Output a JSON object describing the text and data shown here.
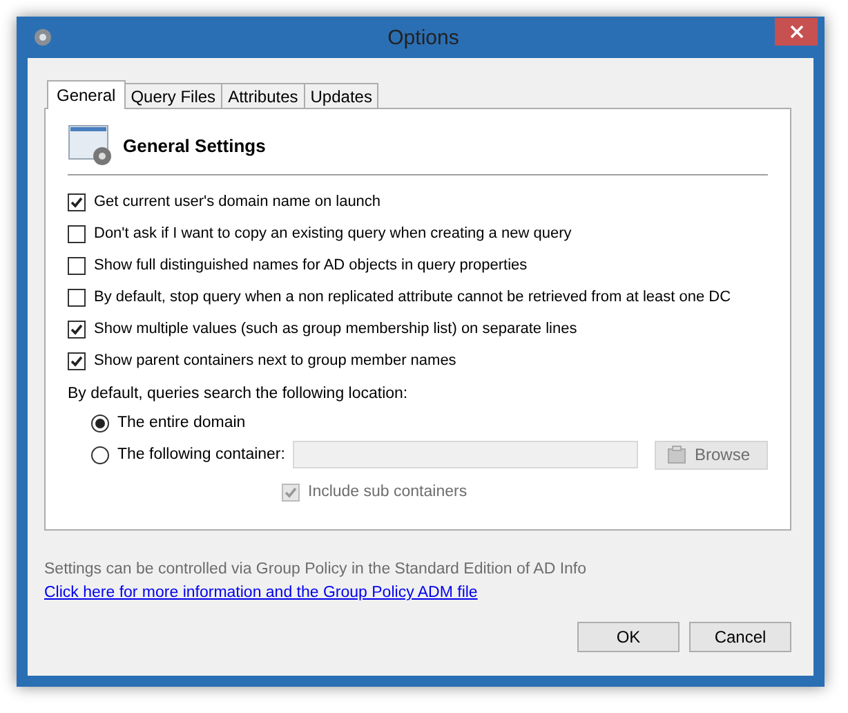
{
  "window": {
    "title": "Options"
  },
  "tabs": [
    {
      "label": "General",
      "selected": true
    },
    {
      "label": "Query Files",
      "selected": false
    },
    {
      "label": "Attributes",
      "selected": false
    },
    {
      "label": "Updates",
      "selected": false
    }
  ],
  "section_title": "General Settings",
  "options": [
    {
      "label": "Get current user's domain name on launch",
      "checked": true
    },
    {
      "label": "Don't ask if I want to copy an existing query when creating a new query",
      "checked": false
    },
    {
      "label": "Show full distinguished names for AD objects in query properties",
      "checked": false
    },
    {
      "label": "By default, stop query when a non replicated attribute cannot be retrieved from at least one DC",
      "checked": false
    },
    {
      "label": "Show multiple values (such as group membership list) on separate lines",
      "checked": true
    },
    {
      "label": "Show parent containers next to group member names",
      "checked": true
    }
  ],
  "location": {
    "label": "By default, queries search the following location:",
    "choices": [
      {
        "label": "The entire domain",
        "selected": true
      },
      {
        "label": "The following container:",
        "selected": false
      }
    ],
    "container_field": {
      "disabled": true
    },
    "browse_button": {
      "label": "Browse",
      "disabled": true
    },
    "include_sub": {
      "label": "Include sub containers",
      "checked": true,
      "disabled": true
    }
  },
  "policy_note": "Settings can be controlled via Group Policy in the Standard Edition of AD Info",
  "policy_link": "Click here for more information and the Group Policy ADM file",
  "buttons": [
    "OK",
    "Cancel"
  ]
}
